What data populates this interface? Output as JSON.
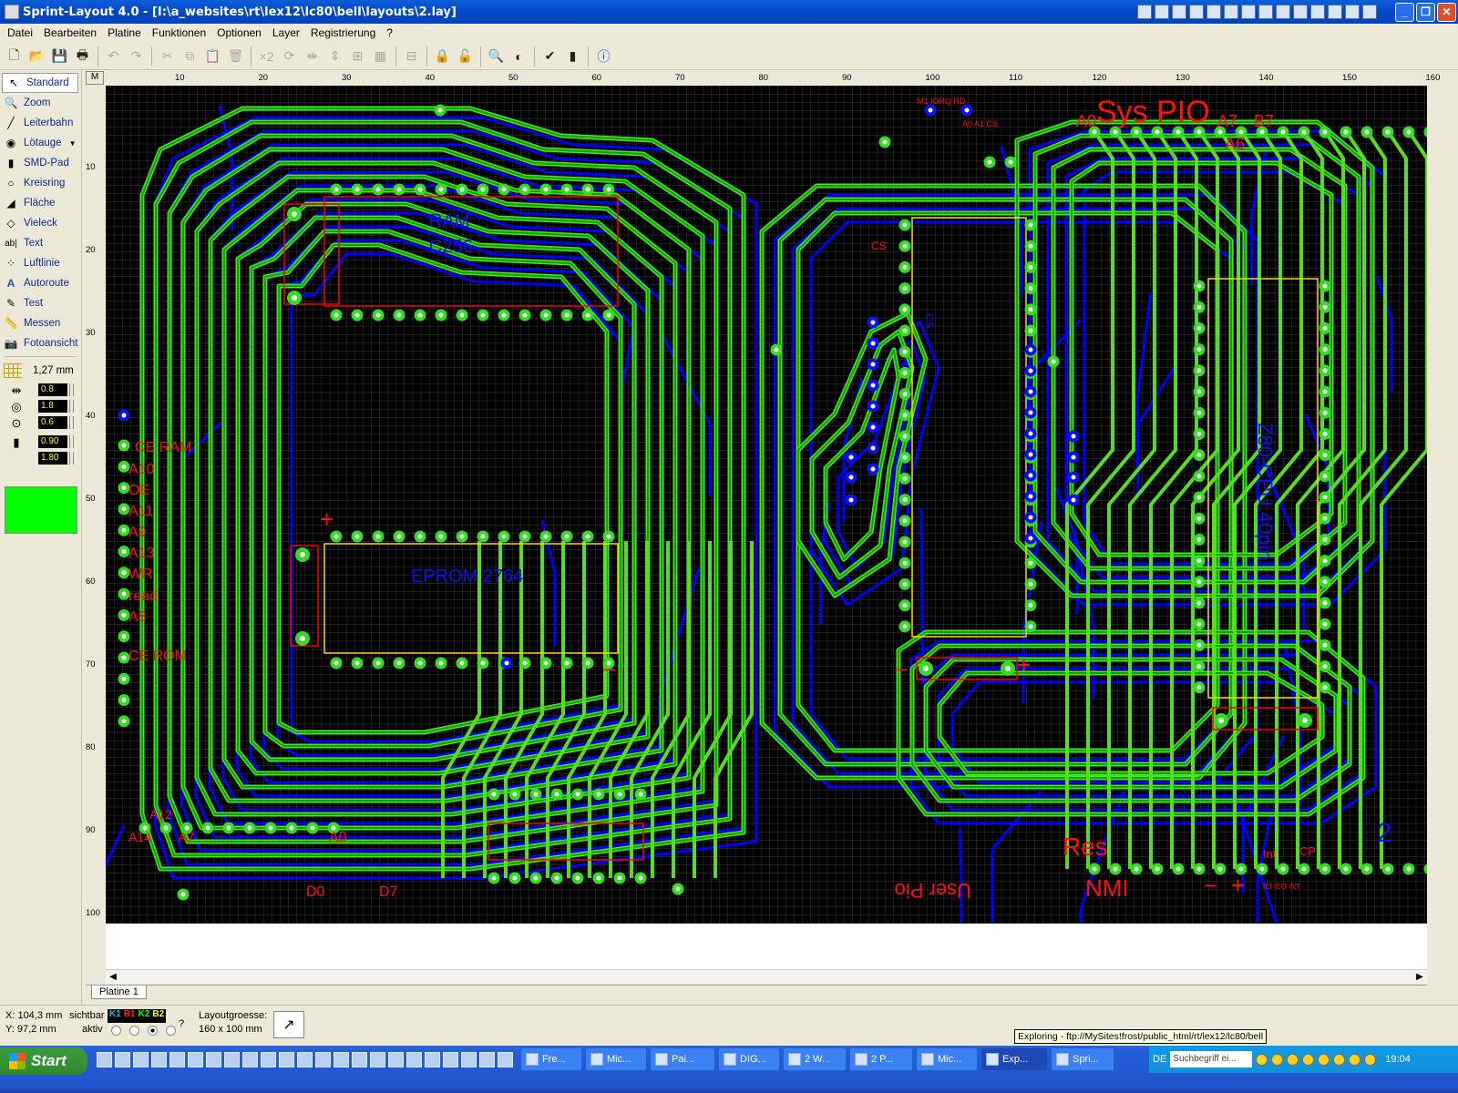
{
  "window": {
    "title": "Sprint-Layout 4.0 - [I:\\a_websites\\rt\\lex12\\lc80\\bell\\layouts\\2.lay]"
  },
  "menu": [
    "Datei",
    "Bearbeiten",
    "Platine",
    "Funktionen",
    "Optionen",
    "Layer",
    "Registrierung",
    "?"
  ],
  "tools": [
    {
      "label": "Standard",
      "icon": "arrow"
    },
    {
      "label": "Zoom",
      "icon": "magnifier"
    },
    {
      "label": "Leiterbahn",
      "icon": "track"
    },
    {
      "label": "Lötauge",
      "icon": "pad"
    },
    {
      "label": "SMD-Pad",
      "icon": "smd"
    },
    {
      "label": "Kreisring",
      "icon": "ring"
    },
    {
      "label": "Fläche",
      "icon": "area"
    },
    {
      "label": "Vieleck",
      "icon": "polygon"
    },
    {
      "label": "Text",
      "icon": "text"
    },
    {
      "label": "Luftlinie",
      "icon": "airwire"
    },
    {
      "label": "Autoroute",
      "icon": "autoroute"
    },
    {
      "label": "Test",
      "icon": "test"
    },
    {
      "label": "Messen",
      "icon": "measure"
    },
    {
      "label": "Fotoansicht",
      "icon": "camera"
    }
  ],
  "grid": {
    "label": "1,27 mm"
  },
  "params": {
    "track_width": "0.8",
    "pad_outer": "1.8",
    "pad_inner": "0.6",
    "smd_w": "0.90",
    "smd_h": "1.80"
  },
  "colors": {
    "current": "#00ff00",
    "background": "#000000",
    "top_copper": "#00cc00",
    "bottom_copper": "#0000ff",
    "silk": "#ff0000",
    "outline": "#ffd700"
  },
  "ruler": {
    "marker": "M",
    "h": [
      "10",
      "20",
      "30",
      "40",
      "50",
      "60",
      "70",
      "80",
      "90",
      "100",
      "110",
      "120",
      "130",
      "140",
      "150",
      "160"
    ],
    "v": [
      "10",
      "20",
      "30",
      "40",
      "50",
      "60",
      "70",
      "80",
      "90",
      "100"
    ]
  },
  "pcb_labels": {
    "sys_pio": "Sys PIO",
    "a0_top": "A0",
    "a6": "A6",
    "a7": "A7",
    "b7": "B7",
    "ram": "RAM",
    "c256": "C256",
    "ce_ram": "CE RAM",
    "a10": "A10",
    "oe": "OE",
    "a11": "A11",
    "a9": "A9",
    "a13": "A13",
    "wr": "WR",
    "read": "read",
    "a8": "A8",
    "ce_rom": "CE ROM",
    "eprom": "EPROM 2764",
    "a12": "A12",
    "a14": "A14",
    "a7b": "A7",
    "a0b": "A0",
    "d0": "D0",
    "d7": "D7",
    "res": "Res",
    "nmi": "NMI",
    "user_pio": "User Pio",
    "int": "Int",
    "cp": "CP",
    "two": "2",
    "cpu": "Z80-CPU 40pin",
    "cs": "CS",
    "tiny1": "M1 IORQ RD",
    "tiny2": "A0 A1 CS",
    "tiny3": "IEI IEO INT"
  },
  "tab": {
    "label": "Platine 1"
  },
  "status": {
    "x": "X: 104,3 mm",
    "y": "Y: 97,2 mm",
    "sichtbar": "sichtbar",
    "aktiv": "aktiv",
    "layers": [
      {
        "name": "K1",
        "color": "#00c0ff"
      },
      {
        "name": "B1",
        "color": "#ff2020"
      },
      {
        "name": "K2",
        "color": "#00ff00"
      },
      {
        "name": "B2",
        "color": "#ffff00"
      }
    ],
    "q": "?",
    "size_label": "Layoutgroesse:",
    "size": "160 x 100 mm"
  },
  "tooltip": "Exploring - ftp://MySites!frost/public_html/rt/lex12/lc80/bell",
  "taskbar": {
    "start": "Start",
    "tasks": [
      "Fre...",
      "Mic...",
      "Pai...",
      "DIG...",
      "2 W...",
      "2 P...",
      "Mic...",
      "Exp...",
      "Spri..."
    ],
    "lang": "DE",
    "search": "Suchbegriff ei...",
    "clock": "19:04"
  }
}
